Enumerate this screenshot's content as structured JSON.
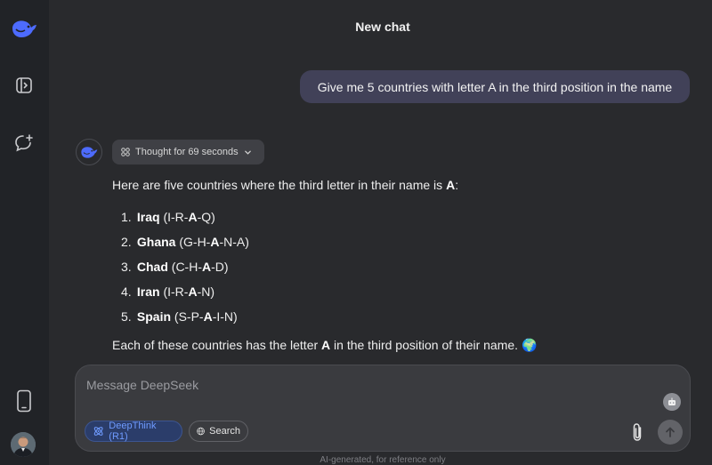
{
  "header": {
    "title": "New chat"
  },
  "sidebar": {
    "items": [
      {
        "name": "logo",
        "icon": "whale-logo-icon"
      },
      {
        "name": "toggle-sidebar",
        "icon": "sidebar-toggle-icon"
      },
      {
        "name": "new-chat",
        "icon": "new-chat-icon"
      },
      {
        "name": "get-app",
        "icon": "phone-icon"
      }
    ],
    "accent": "#4d6bfe"
  },
  "conversation": {
    "user_message": "Give me 5 countries with letter A in the third position in the name",
    "thought_label": "Thought for 69 seconds",
    "answer": {
      "intro_pre": "Here are five countries where the third letter in their name is ",
      "intro_bold": "A",
      "intro_post": ":",
      "items": [
        {
          "num": "1.",
          "name": "Iraq",
          "pre": "(I-R-",
          "letter": "A",
          "post": "-Q)"
        },
        {
          "num": "2.",
          "name": "Ghana",
          "pre": "(G-H-",
          "letter": "A",
          "post": "-N-A)"
        },
        {
          "num": "3.",
          "name": "Chad",
          "pre": "(C-H-",
          "letter": "A",
          "post": "-D)"
        },
        {
          "num": "4.",
          "name": "Iran",
          "pre": "(I-R-",
          "letter": "A",
          "post": "-N)"
        },
        {
          "num": "5.",
          "name": "Spain",
          "pre": "(S-P-",
          "letter": "A",
          "post": "-I-N)"
        }
      ],
      "outro_pre": "Each of these countries has the letter ",
      "outro_bold": "A",
      "outro_post": " in the third position of their name.",
      "outro_emoji": "🌍"
    }
  },
  "composer": {
    "placeholder": "Message DeepSeek",
    "deepthink_label": "DeepThink (R1)",
    "search_label": "Search"
  },
  "footer": {
    "disclaimer": "AI-generated, for reference only"
  },
  "colors": {
    "background": "#292a2d",
    "sidebar": "#212327",
    "user_bubble": "#414158",
    "deepthink_text": "#6f9bff"
  }
}
